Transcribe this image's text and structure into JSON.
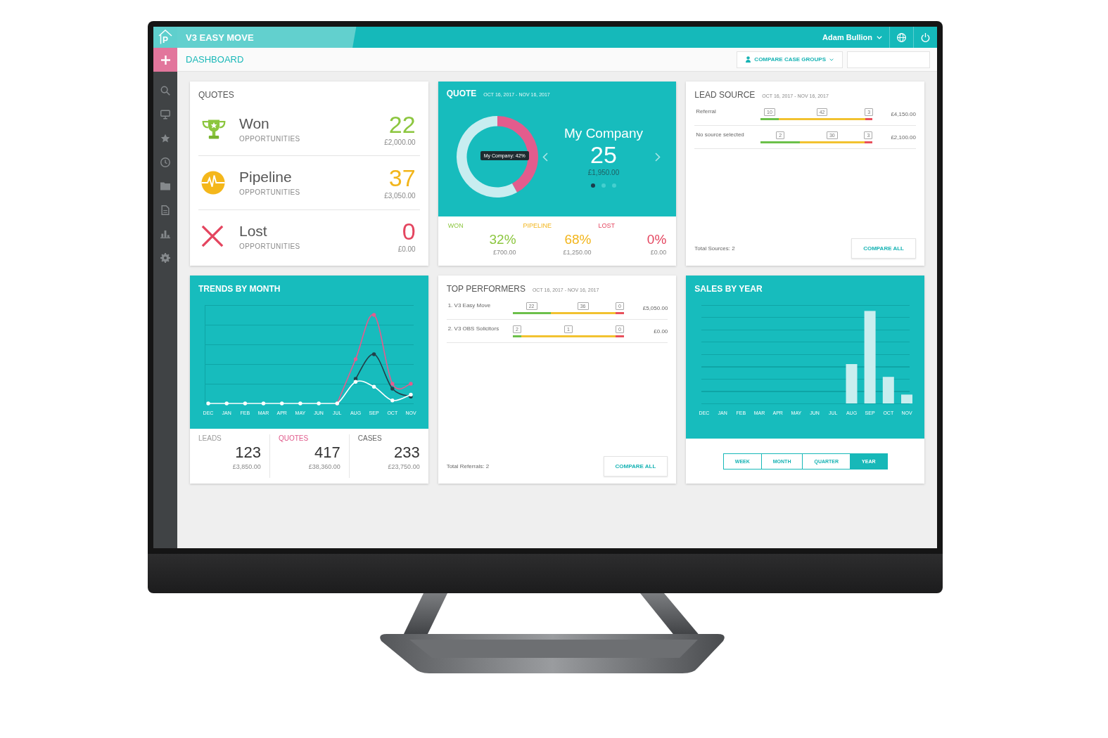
{
  "app": {
    "logo_mark": "P",
    "name": "V3 EASY MOVE"
  },
  "user_menu": {
    "name": "Adam Bullion"
  },
  "page_title": "DASHBOARD",
  "toolbar": {
    "group_button": "COMPARE CASE GROUPS"
  },
  "quotes_card": {
    "title": "QUOTES",
    "rows": [
      {
        "kind": "won",
        "label": "Won",
        "caption": "OPPORTUNITIES",
        "count": "22",
        "amount": "£2,000.00"
      },
      {
        "kind": "pipeline",
        "label": "Pipeline",
        "caption": "OPPORTUNITIES",
        "count": "37",
        "amount": "£3,050.00"
      },
      {
        "kind": "lost",
        "label": "Lost",
        "caption": "OPPORTUNITIES",
        "count": "0",
        "amount": "£0.00"
      }
    ]
  },
  "quote_card": {
    "title": "QUOTE",
    "date_range": "OCT 16, 2017 - NOV 16, 2017",
    "chart_data": {
      "type": "donut",
      "values": [
        42,
        58
      ],
      "annotations": [
        "My Company: 42%"
      ]
    },
    "company": "My Company",
    "count": "25",
    "amount": "£1,950.00",
    "pages": [
      {
        "selected": true
      },
      {
        "selected": false
      },
      {
        "selected": false
      }
    ],
    "breakdown": [
      {
        "kind": "won",
        "label": "WON",
        "percent": "32%",
        "amount": "£700.00"
      },
      {
        "kind": "pipeline",
        "label": "PIPELINE",
        "percent": "68%",
        "amount": "£1,250.00"
      },
      {
        "kind": "lost",
        "label": "LOST",
        "percent": "0%",
        "amount": "£0.00"
      }
    ]
  },
  "lead_source_card": {
    "title": "LEAD SOURCE",
    "date_range": "OCT 16, 2017 - NOV 16, 2017",
    "rows": [
      {
        "label": "Referral",
        "segments": [
          {
            "count": "10",
            "level": 0.16,
            "color": "#6cc04a"
          },
          {
            "count": "42",
            "color": "#f2c230"
          },
          {
            "count": "3",
            "level": 0.06,
            "color": "#e8505b"
          }
        ],
        "amount": "£4,150.00"
      },
      {
        "label": "No source selected",
        "segments": [
          {
            "count": "2",
            "level": 0.35,
            "color": "#6cc04a"
          },
          {
            "count": "30",
            "color": "#f2c230"
          },
          {
            "count": "3",
            "level": 0.07,
            "color": "#e8505b"
          }
        ],
        "amount": "£2,100.00"
      }
    ],
    "footer_text": "Total Sources: 2",
    "button": "COMPARE ALL"
  },
  "trends_card": {
    "title": "TRENDS BY MONTH",
    "months": [
      "DEC",
      "JAN",
      "FEB",
      "MAR",
      "APR",
      "MAY",
      "JUN",
      "JUL",
      "AUG",
      "SEP",
      "OCT",
      "NOV"
    ],
    "totals": [
      {
        "kind": "leads",
        "label": "LEADS",
        "count": "123",
        "amount": "£3,850.00"
      },
      {
        "kind": "quotes",
        "label": "QUOTES",
        "count": "417",
        "amount": "£38,360.00"
      },
      {
        "kind": "cases",
        "label": "CASES",
        "count": "233",
        "amount": "£23,750.00"
      }
    ]
  },
  "top_performers_card": {
    "title": "TOP PERFORMERS",
    "date_range": "OCT 16, 2017 - NOV 16, 2017",
    "rows": [
      {
        "label": "1. V3 Easy Move",
        "segments": [
          {
            "count": "22",
            "level": 0.34,
            "color": "#6cc04a"
          },
          {
            "count": "36",
            "color": "#f2c230"
          },
          {
            "count": "0",
            "level": 0.08,
            "color": "#e8505b"
          }
        ],
        "amount": "£5,050.00"
      },
      {
        "label": "2. V3 OBS Solicitors",
        "segments": [
          {
            "count": "2",
            "level": 0.08,
            "color": "#6cc04a"
          },
          {
            "count": "1",
            "color": "#f2c230"
          },
          {
            "count": "0",
            "level": 0.08,
            "color": "#e8505b"
          }
        ],
        "amount": "£0.00"
      }
    ],
    "footer_text": "Total Referrals: 2",
    "button": "COMPARE ALL"
  },
  "sales_card": {
    "title": "SALES BY YEAR",
    "months": [
      "DEC",
      "JAN",
      "FEB",
      "MAR",
      "APR",
      "MAY",
      "JUN",
      "JUL",
      "AUG",
      "SEP",
      "OCT",
      "NOV"
    ],
    "periods": [
      {
        "label": "WEEK",
        "selected": false
      },
      {
        "label": "MONTH",
        "selected": false
      },
      {
        "label": "QUARTER",
        "selected": false
      },
      {
        "label": "YEAR",
        "selected": true
      }
    ]
  }
}
